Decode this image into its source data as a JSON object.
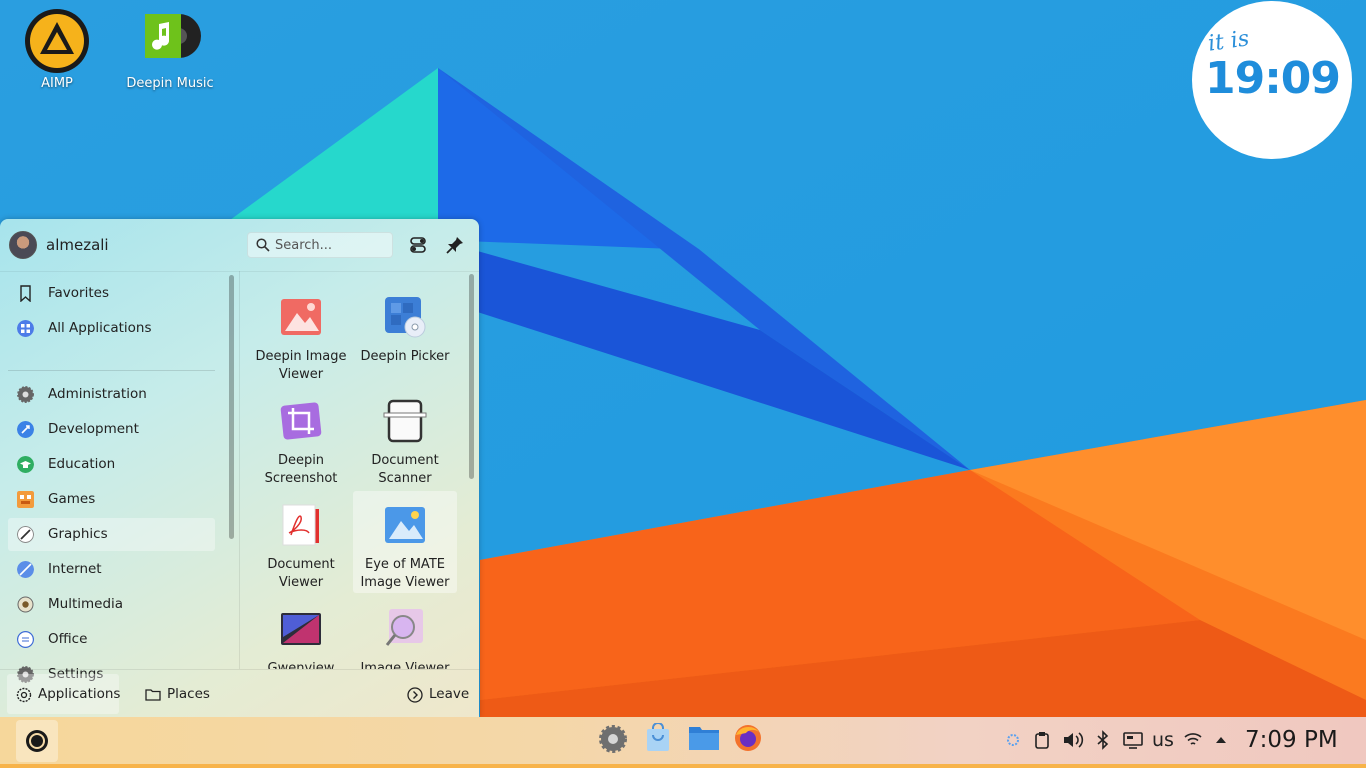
{
  "desktop": {
    "icons": [
      {
        "label": "AIMP",
        "icon": "aimp-icon"
      },
      {
        "label": "Deepin Music",
        "icon": "music-icon"
      }
    ]
  },
  "clock_widget": {
    "prefix": "it is",
    "time": "19:09"
  },
  "launcher": {
    "user": {
      "name": "almezali"
    },
    "search": {
      "placeholder": "Search..."
    },
    "categories": [
      {
        "label": "Favorites",
        "icon": "bookmark-icon"
      },
      {
        "label": "All Applications",
        "icon": "grid-icon"
      },
      {
        "label": "Administration",
        "icon": "gear-icon"
      },
      {
        "label": "Development",
        "icon": "wrench-icon"
      },
      {
        "label": "Education",
        "icon": "graduation-cap-icon"
      },
      {
        "label": "Games",
        "icon": "game-icon"
      },
      {
        "label": "Graphics",
        "icon": "brush-icon"
      },
      {
        "label": "Internet",
        "icon": "globe-icon"
      },
      {
        "label": "Multimedia",
        "icon": "speaker-icon"
      },
      {
        "label": "Office",
        "icon": "document-icon"
      },
      {
        "label": "Settings",
        "icon": "settings-icon"
      }
    ],
    "active_category": "Graphics",
    "apps": [
      {
        "label": "Deepin Image Viewer",
        "icon": "image-viewer-icon"
      },
      {
        "label": "Deepin Picker",
        "icon": "color-picker-icon"
      },
      {
        "label": "Deepin Screenshot",
        "icon": "screenshot-icon"
      },
      {
        "label": "Document Scanner",
        "icon": "scanner-icon"
      },
      {
        "label": "Document Viewer",
        "icon": "pdf-icon"
      },
      {
        "label": "Eye of MATE Image Viewer",
        "icon": "eye-of-mate-icon"
      },
      {
        "label": "Gwenview",
        "icon": "gwenview-icon"
      },
      {
        "label": "Image Viewer",
        "icon": "magnifier-image-icon"
      }
    ],
    "footer": {
      "applications": "Applications",
      "places": "Places",
      "leave": "Leave"
    }
  },
  "taskbar": {
    "keyboard_layout": "us",
    "clock": "7:09 PM"
  },
  "colors": {
    "accent": "#1f8ddb",
    "taskbar": "#f6d79b"
  }
}
